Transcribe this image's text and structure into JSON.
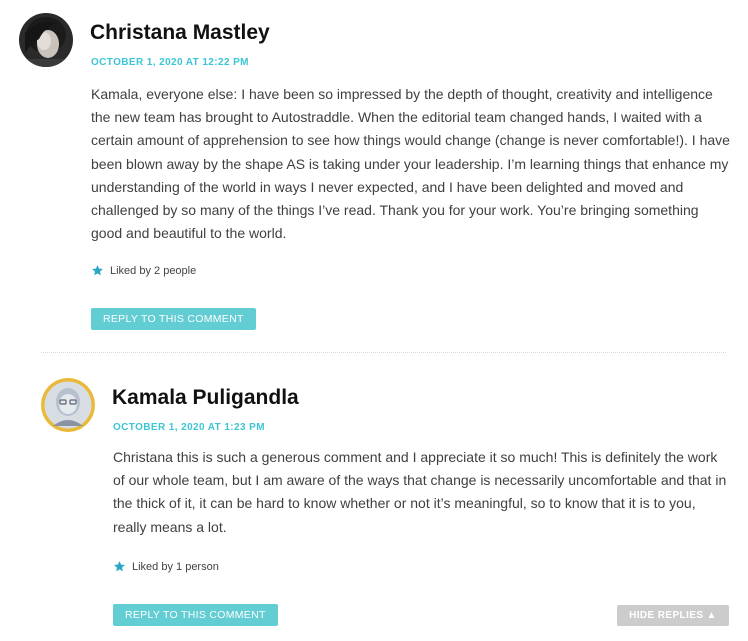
{
  "comments": [
    {
      "author": "Christana Mastley",
      "date": "OCTOBER 1, 2020 AT 12:22 PM",
      "text": "Kamala, everyone else: I have been so impressed by the depth of thought, creativity and intelligence the new team has brought to Autostraddle. When the editorial team changed hands, I waited with a certain amount of apprehension to see how things would change (change is never comfortable!). I have been blown away by the shape AS is taking under your leadership. I’m learning things that enhance my understanding of the world in ways I never expected, and I have been delighted and moved and challenged by so many of the things I’ve read. Thank you for your work. You’re bringing something good and beautiful to the world.",
      "likes": "Liked by 2 people",
      "reply_label": "REPLY TO THIS COMMENT",
      "like_icon": "star-icon"
    },
    {
      "author": "Kamala Puligandla",
      "date": "OCTOBER 1, 2020 AT 1:23 PM",
      "text": "Christana this is such a generous comment and I appreciate it so much! This is definitely the work of our whole team, but I am aware of the ways that change is necessarily uncomfortable and that in the thick of it, it can be hard to know whether or not it’s meaningful, so to know that it is to you, really means a lot.",
      "likes": "Liked by 1 person",
      "reply_label": "REPLY TO THIS COMMENT",
      "like_icon": "star-icon"
    }
  ],
  "hide_replies_label": "HIDE REPLIES ▲",
  "colors": {
    "accent": "#3cc5d4",
    "button": "#62cdd3",
    "hide_button": "#cccccc",
    "avatar_ring": "#e9b93a"
  }
}
